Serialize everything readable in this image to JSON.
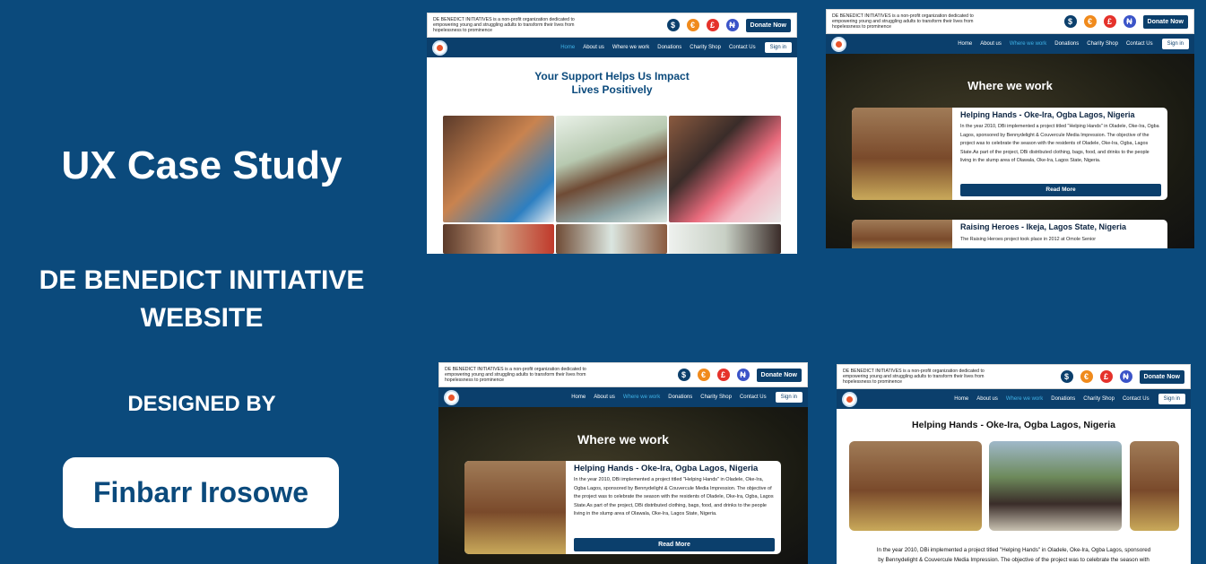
{
  "left": {
    "title": "UX Case Study",
    "project_line1": "DE BENEDICT INITIATIVE",
    "project_line2": "WEBSITE",
    "designed_by": "DESIGNED BY",
    "author": "Finbarr Irosowe"
  },
  "site": {
    "tagline": "DE BENEDICT INITIATIVES is a non-profit organization dedicated to empowering young and struggling adults to transform their lives from hopelessness to prominence",
    "currencies": [
      {
        "symbol": "$",
        "color": "#0b3f6c"
      },
      {
        "symbol": "€",
        "color": "#f08a1c"
      },
      {
        "symbol": "£",
        "color": "#e5322b"
      },
      {
        "symbol": "₦",
        "color": "#3b54c8"
      }
    ],
    "donate": "Donate Now",
    "nav": [
      "Home",
      "About us",
      "Where we work",
      "Donations",
      "Charity Shop",
      "Contact Us"
    ],
    "signin": "Sign in"
  },
  "screen1": {
    "heading_line1": "Your Support Helps Us Impact",
    "heading_line2": "Lives Positively"
  },
  "screen2": {
    "section_title": "Where we work",
    "card1": {
      "title": "Helping Hands - Oke-Ira, Ogba Lagos, Nigeria",
      "body": "In the year 2010, DBi implemented a project titled \"Helping Hands\" in Oladele, Oke-Ira, Ogba Lagos, sponsored by Bennydelight & Couvercule Media Impression. The objective of the project was to celebrate the season with the residents of Oladele, Oke-Ira, Ogba, Lagos State.As part of the project, DBi distributed clothing, bags, food, and drinks to the people living in the slump area of Olawala, Oke-Ira, Lagos State, Nigeria.",
      "button": "Read More"
    },
    "card2": {
      "title": "Raising Heroes - Ikeja, Lagos State, Nigeria",
      "body": "The Raising Heroes project took place in 2012 at Omole Senior"
    }
  },
  "screen3": {
    "section_title": "Where we work",
    "card1": {
      "title": "Helping Hands - Oke-Ira, Ogba Lagos, Nigeria",
      "body": "In the year 2010, DBi implemented a project titled \"Helping Hands\" in Oladele, Oke-Ira, Ogba Lagos, sponsored by Bennydelight & Couvercule Media Impression. The objective of the project was to celebrate the season with the residents of Oladele, Oke-Ira, Ogba, Lagos State.As part of the project, DBi distributed clothing, bags, food, and drinks to the people living in the slump area of Olawala, Oke-Ira, Lagos State, Nigeria.",
      "button": "Read More"
    }
  },
  "screen4": {
    "title": "Helping Hands - Oke-Ira, Ogba Lagos, Nigeria",
    "text_line1": "In the year 2010, DBi implemented a project titled \"Helping Hands\" in Oladele, Oke-Ira, Ogba Lagos, sponsored",
    "text_line2": "by Bennydelight & Couvercule Media Impression. The objective of the project was to celebrate the season with"
  }
}
